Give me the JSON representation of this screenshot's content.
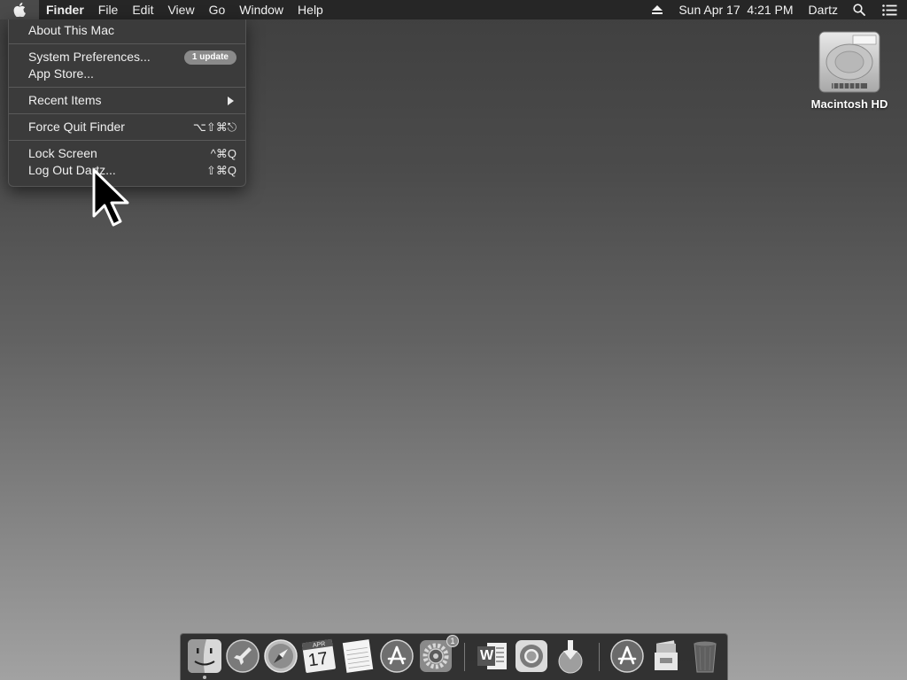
{
  "menubar": {
    "apple_icon": "apple-logo-icon",
    "app_name": "Finder",
    "menus": [
      "File",
      "Edit",
      "View",
      "Go",
      "Window",
      "Help"
    ],
    "status": {
      "eject_icon": "eject-icon",
      "datetime": "Sun Apr 17  4:21 PM",
      "user": "Dartz",
      "search_icon": "spotlight-search-icon",
      "notification_icon": "notification-center-icon"
    }
  },
  "apple_menu": {
    "about": "About This Mac",
    "system_prefs": "System Preferences...",
    "system_prefs_badge": "1 update",
    "app_store": "App Store...",
    "recent_items": "Recent Items",
    "force_quit": "Force Quit Finder",
    "force_quit_shortcut": "⌥⇧⌘⎋",
    "lock_screen": "Lock Screen",
    "lock_screen_shortcut": "^⌘Q",
    "log_out": "Log Out Dartz...",
    "log_out_shortcut": "⇧⌘Q"
  },
  "desktop": {
    "hd_label": "Macintosh HD",
    "hd_icon": "hard-drive-icon"
  },
  "dock": {
    "apps": [
      {
        "name": "Finder",
        "icon": "finder-icon",
        "running": true
      },
      {
        "name": "Launchpad",
        "icon": "launchpad-icon"
      },
      {
        "name": "Safari",
        "icon": "safari-icon"
      },
      {
        "name": "Calendar",
        "icon": "calendar-icon",
        "text_month": "APR",
        "text_day": "17"
      },
      {
        "name": "Notes",
        "icon": "notes-icon"
      },
      {
        "name": "App Store",
        "icon": "app-store-icon"
      },
      {
        "name": "System Preferences",
        "icon": "system-preferences-icon",
        "badge": "1"
      },
      {
        "name": "Microsoft Word",
        "icon": "word-icon",
        "letter": "W"
      },
      {
        "name": "Chrome",
        "icon": "chrome-icon"
      },
      {
        "name": "Installer",
        "icon": "installer-icon"
      },
      {
        "name": "Applications",
        "icon": "applications-folder-icon"
      },
      {
        "name": "Downloads",
        "icon": "downloads-stack-icon"
      },
      {
        "name": "Trash",
        "icon": "trash-icon"
      }
    ]
  }
}
